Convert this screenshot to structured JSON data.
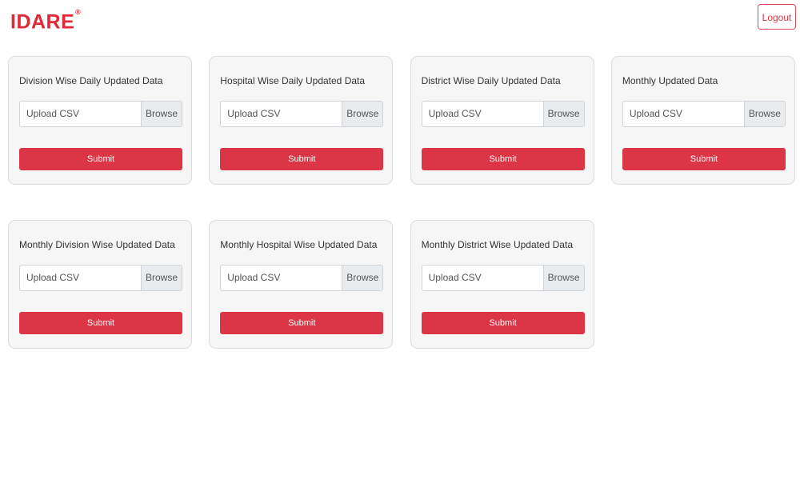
{
  "header": {
    "logo_text": "IDARE",
    "logo_mark": "®",
    "logout_label": "Logout"
  },
  "cards": [
    {
      "title": "Division Wise Daily Updated Data",
      "upload_placeholder": "Upload CSV",
      "browse_label": "Browse",
      "submit_label": "Submit"
    },
    {
      "title": "Hospital Wise Daily Updated Data",
      "upload_placeholder": "Upload CSV",
      "browse_label": "Browse",
      "submit_label": "Submit"
    },
    {
      "title": "District Wise Daily Updated Data",
      "upload_placeholder": "Upload CSV",
      "browse_label": "Browse",
      "submit_label": "Submit"
    },
    {
      "title": "Monthly Updated Data",
      "upload_placeholder": "Upload CSV",
      "browse_label": "Browse",
      "submit_label": "Submit"
    },
    {
      "title": "Monthly Division Wise Updated Data",
      "upload_placeholder": "Upload CSV",
      "browse_label": "Browse",
      "submit_label": "Submit"
    },
    {
      "title": "Monthly Hospital Wise Updated Data",
      "upload_placeholder": "Upload CSV",
      "browse_label": "Browse",
      "submit_label": "Submit"
    },
    {
      "title": "Monthly District Wise Updated Data",
      "upload_placeholder": "Upload CSV",
      "browse_label": "Browse",
      "submit_label": "Submit"
    }
  ],
  "colors": {
    "brand": "#e12836",
    "submit": "#dc3545",
    "card_bg": "#f6f6f7"
  }
}
